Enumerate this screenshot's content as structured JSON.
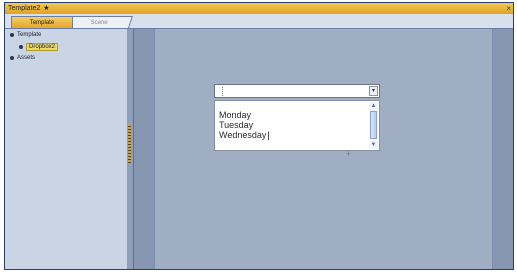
{
  "window": {
    "title": "Template2",
    "modified_marker": "★",
    "close_glyph": "×"
  },
  "tabs": [
    {
      "label": "Template",
      "active": true
    },
    {
      "label": "Scene",
      "active": false
    }
  ],
  "tree": {
    "root_label": "Template",
    "child_label": "Dropbox2",
    "assets_label": "Assets"
  },
  "combo": {
    "dropdown_glyph": "▾"
  },
  "list": {
    "items": [
      "Monday",
      "Tuesday",
      "Wednesday"
    ],
    "scroll_up_glyph": "▲",
    "scroll_down_glyph": "▼"
  },
  "canvas": {
    "crosshair_glyph": "+"
  },
  "icons": [
    "star-icon",
    "close-icon",
    "tree-bullet-icon",
    "dropdown-arrow-icon",
    "crosshair-icon"
  ],
  "colors": {
    "title_accent": "#e8b53a",
    "canvas": "#a0aec3",
    "selection": "#e9d96b"
  }
}
